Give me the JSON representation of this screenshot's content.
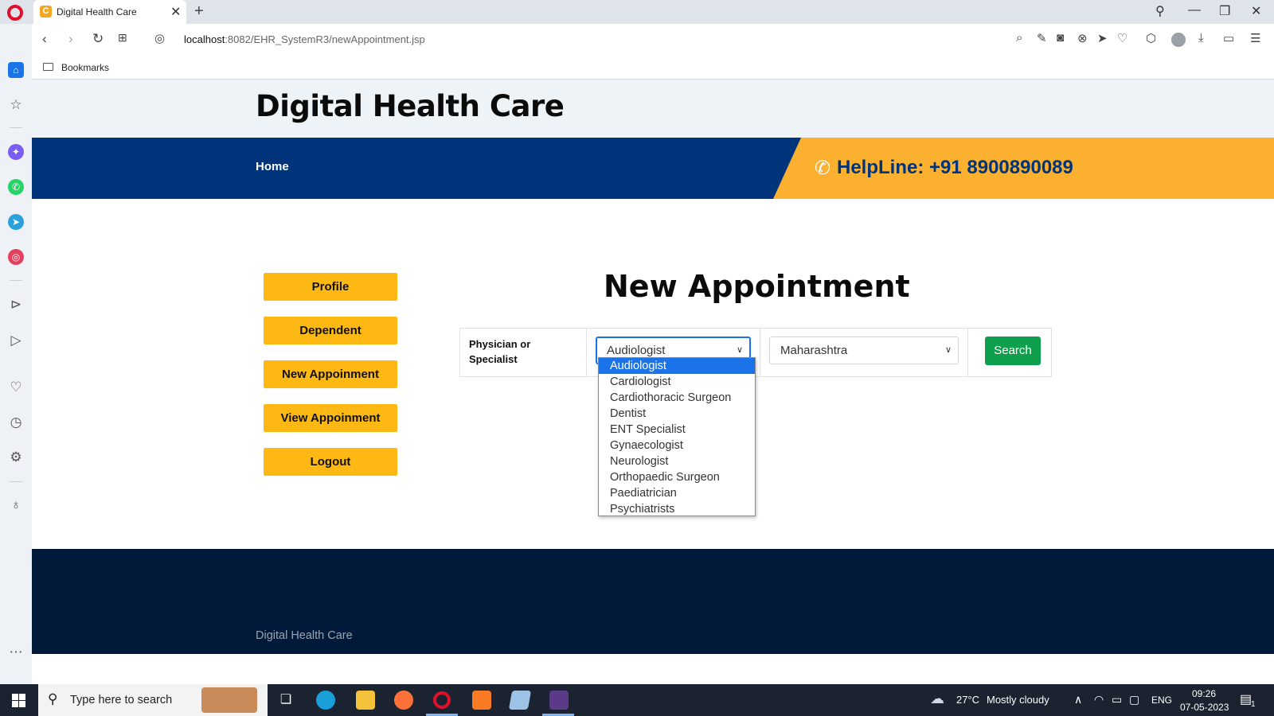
{
  "browser": {
    "tab_title": "Digital Health Care",
    "tab_favicon_letter": "C",
    "url_host": "localhost",
    "url_path": ":8082/EHR_SystemR3/newAppointment.jsp",
    "bookmarks_label": "Bookmarks"
  },
  "site": {
    "title": "Digital Health Care",
    "nav_home": "Home",
    "helpline": "HelpLine: +91 8900890089"
  },
  "menu": {
    "items": [
      "Profile",
      "Dependent",
      "New Appoinment",
      "View Appoinment",
      "Logout"
    ]
  },
  "main": {
    "heading": "New Appointment",
    "form_label": "Physician or Specialist",
    "specialist_selected": "Audiologist",
    "state_selected": "Maharashtra",
    "search_label": "Search",
    "specialist_options": [
      "Audiologist",
      "Cardiologist",
      "Cardiothoracic Surgeon",
      "Dentist",
      "ENT Specialist",
      "Gynaecologist",
      "Neurologist",
      "Orthopaedic Surgeon",
      "Paediatrician",
      "Psychiatrists"
    ]
  },
  "footer": {
    "text": "Digital Health Care"
  },
  "taskbar": {
    "search_placeholder": "Type here to search",
    "temperature": "27°C",
    "weather": "Mostly cloudy",
    "language": "ENG",
    "time": "09:26",
    "date": "07-05-2023",
    "notification_count": "1"
  },
  "colors": {
    "navbar": "#00347a",
    "helpline_bg": "#fcb02f",
    "menu_button": "#fdb813",
    "search_button": "#0e9f4c",
    "footer": "#021a3a",
    "selected_option": "#1a73e8"
  }
}
